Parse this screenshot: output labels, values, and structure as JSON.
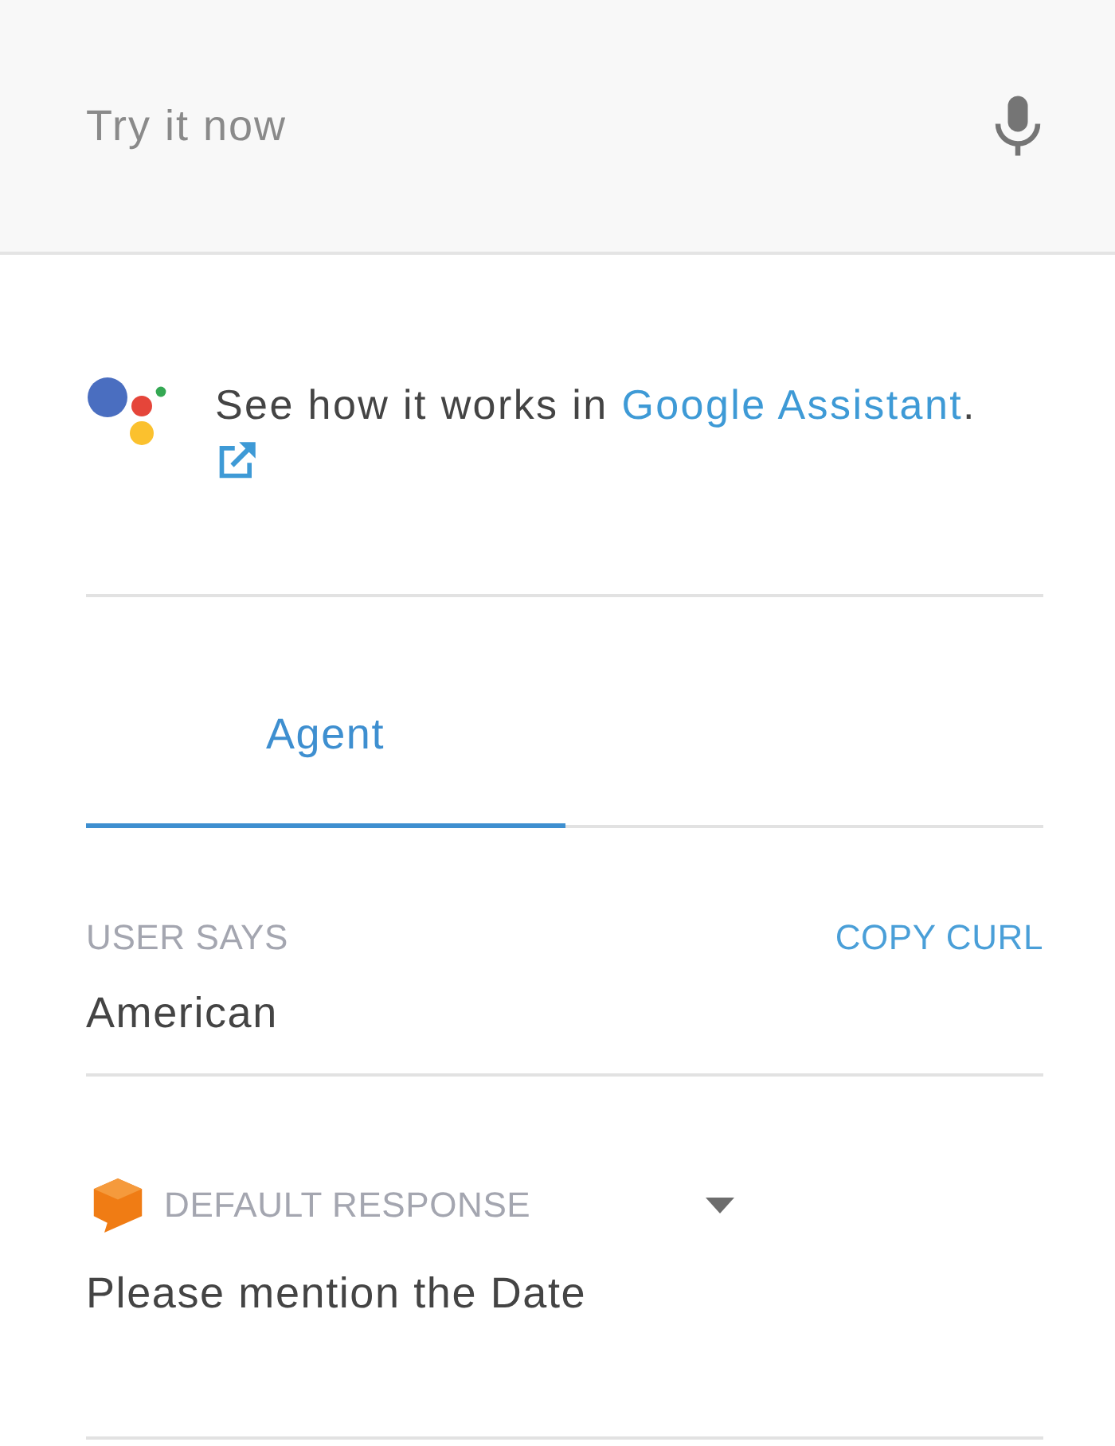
{
  "try_bar": {
    "placeholder": "Try it now"
  },
  "assistant_promo": {
    "text": "See how it works in ",
    "link": "Google Assistant",
    "suffix": "."
  },
  "tabs": [
    {
      "label": "Agent",
      "selected": true
    }
  ],
  "user_says": {
    "label": "USER SAYS",
    "action": "COPY CURL",
    "value": "American"
  },
  "response": {
    "label": "DEFAULT RESPONSE",
    "text": "Please mention the Date"
  }
}
